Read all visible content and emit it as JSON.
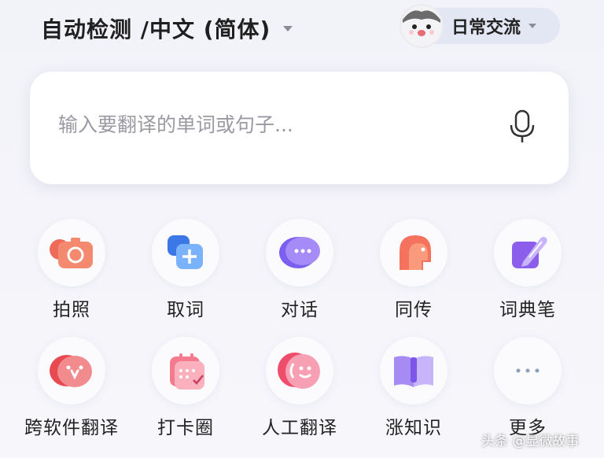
{
  "header": {
    "language_pair": "自动检测 /中文 (简体)",
    "mode_label": "日常交流"
  },
  "search": {
    "placeholder": "输入要翻译的单词或句子..."
  },
  "tools": [
    {
      "label": "拍照",
      "icon": "camera-icon"
    },
    {
      "label": "取词",
      "icon": "word-pick-icon"
    },
    {
      "label": "对话",
      "icon": "chat-bubbles-icon"
    },
    {
      "label": "同传",
      "icon": "simultaneous-interpretation-icon"
    },
    {
      "label": "词典笔",
      "icon": "dictionary-pen-icon"
    },
    {
      "label": "跨软件翻译",
      "icon": "cross-app-translate-icon"
    },
    {
      "label": "打卡圈",
      "icon": "calendar-checkin-icon"
    },
    {
      "label": "人工翻译",
      "icon": "human-translator-icon"
    },
    {
      "label": "涨知识",
      "icon": "open-book-icon"
    },
    {
      "label": "更多",
      "icon": "more-dots-icon"
    }
  ],
  "watermark": "头条 @显微故事",
  "colors": {
    "accent_red": "#f05a4f",
    "accent_blue": "#3d8cf0",
    "accent_purple": "#8a6df2",
    "accent_pink": "#f06a8a"
  }
}
